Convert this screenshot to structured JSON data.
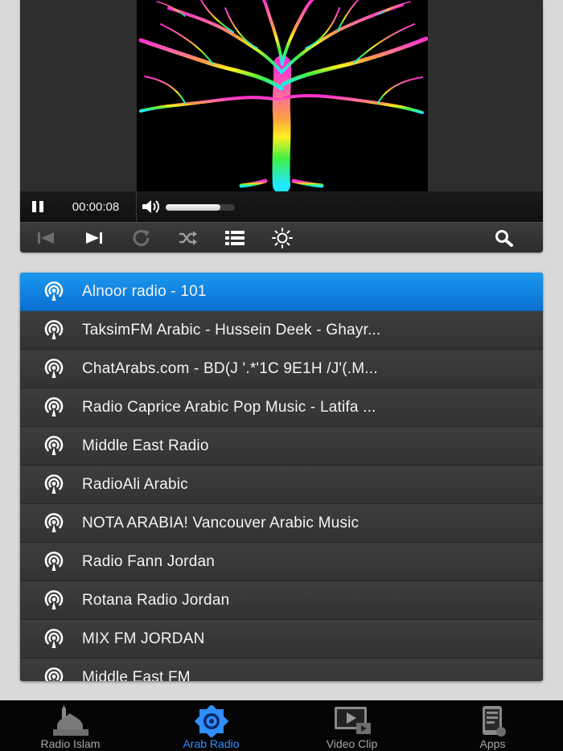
{
  "player": {
    "elapsed": "00:00:08",
    "volume_level": 0.79,
    "is_playing": true
  },
  "stations": [
    {
      "name": "Alnoor radio - 101",
      "selected": true
    },
    {
      "name": "TaksimFM Arabic - Hussein Deek - Ghayr...",
      "selected": false
    },
    {
      "name": "ChatArabs.com - BD(J '.*'1C 9E1H /J'(.M...",
      "selected": false
    },
    {
      "name": "Radio Caprice Arabic Pop Music - Latifa ...",
      "selected": false
    },
    {
      "name": "Middle East Radio",
      "selected": false
    },
    {
      "name": "RadioAli Arabic",
      "selected": false
    },
    {
      "name": "NOTA ARABIA! Vancouver Arabic Music",
      "selected": false
    },
    {
      "name": "Radio Fann Jordan",
      "selected": false
    },
    {
      "name": "Rotana Radio Jordan",
      "selected": false
    },
    {
      "name": "MIX FM JORDAN",
      "selected": false
    },
    {
      "name": "Middle East FM",
      "selected": false
    }
  ],
  "tabs": [
    {
      "label": "Radio Islam",
      "icon": "mosque-icon",
      "active": false
    },
    {
      "label": "Arab Radio",
      "icon": "arab-star-icon",
      "active": true
    },
    {
      "label": "Video Clip",
      "icon": "video-clip-icon",
      "active": false
    },
    {
      "label": "Apps",
      "icon": "apps-icon",
      "active": false
    }
  ],
  "colors": {
    "accent": "#1b98ee",
    "active_tab": "#2f8fff"
  }
}
